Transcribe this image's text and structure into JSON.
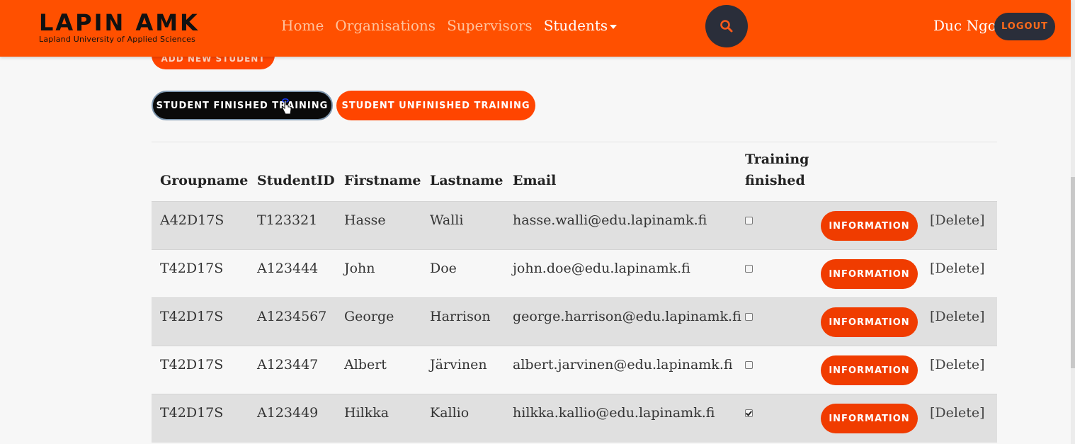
{
  "header": {
    "brand_title": "LAPIN AMK",
    "brand_subtitle": "Lapland University of Applied Sciences",
    "nav": [
      {
        "label": "Home"
      },
      {
        "label": "Organisations"
      },
      {
        "label": "Supervisors"
      },
      {
        "label": "Students"
      }
    ],
    "user_name": "Duc Ngo",
    "logout_label": "LOGOUT"
  },
  "colors": {
    "brand_orange": "#ff5000",
    "button_orange": "#f03c00",
    "dark": "#2a2e3a"
  },
  "toolbar": {
    "add_label": "ADD NEW STUDENT",
    "finished_label": "STUDENT FINISHED TRAINING",
    "unfinished_label": "STUDENT UNFINISHED TRAINING"
  },
  "table": {
    "headers": {
      "group": "Groupname",
      "student_id": "StudentID",
      "firstname": "Firstname",
      "lastname": "Lastname",
      "email": "Email",
      "training_1": "Training",
      "training_2": "finished"
    },
    "info_label": "INFORMATION",
    "delete_label": "[Delete]",
    "rows": [
      {
        "group": "A42D17S",
        "student_id": "T123321",
        "firstname": "Hasse",
        "lastname": "Walli",
        "email": "hasse.walli@edu.lapinamk.fi",
        "finished": false
      },
      {
        "group": "T42D17S",
        "student_id": "A123444",
        "firstname": "John",
        "lastname": "Doe",
        "email": "john.doe@edu.lapinamk.fi",
        "finished": false
      },
      {
        "group": "T42D17S",
        "student_id": "A1234567",
        "firstname": "George",
        "lastname": "Harrison",
        "email": "george.harrison@edu.lapinamk.fi",
        "finished": false
      },
      {
        "group": "T42D17S",
        "student_id": "A123447",
        "firstname": "Albert",
        "lastname": "Järvinen",
        "email": "albert.jarvinen@edu.lapinamk.fi",
        "finished": false
      },
      {
        "group": "T42D17S",
        "student_id": "A123449",
        "firstname": "Hilkka",
        "lastname": "Kallio",
        "email": "hilkka.kallio@edu.lapinamk.fi",
        "finished": true
      }
    ]
  }
}
